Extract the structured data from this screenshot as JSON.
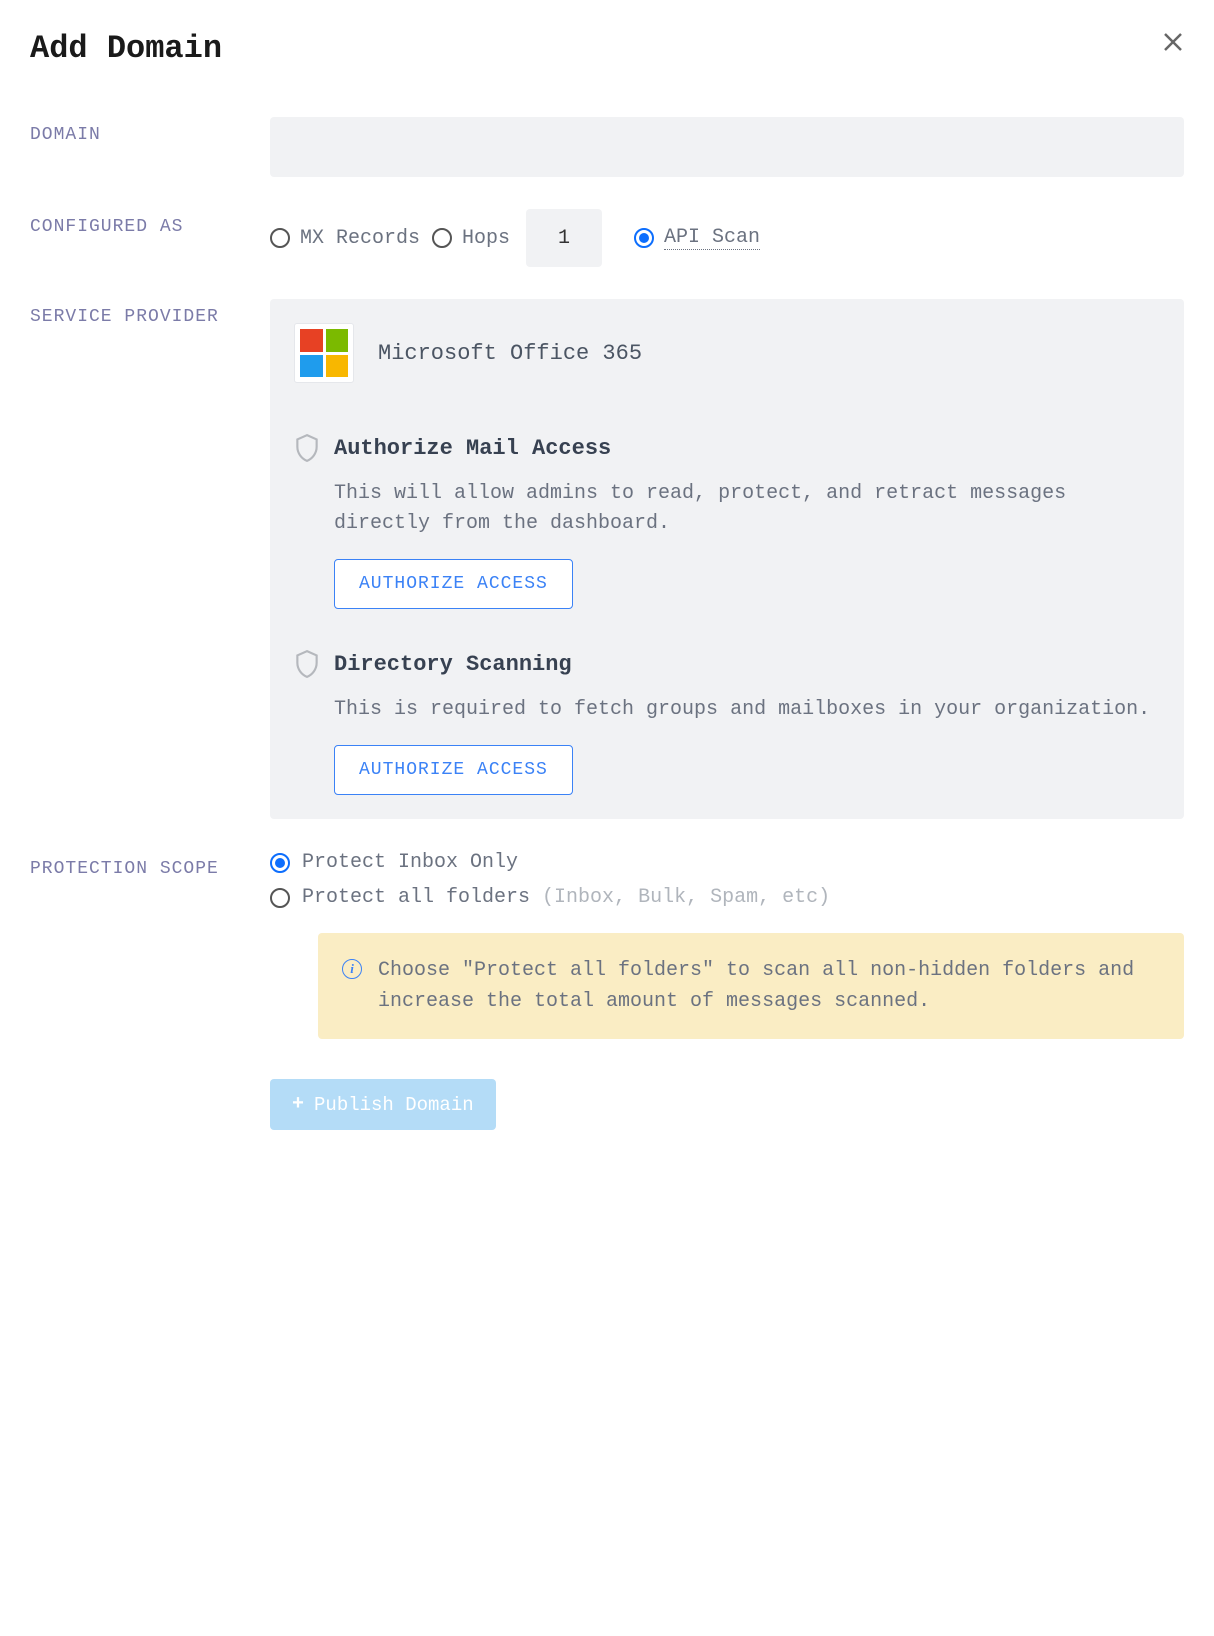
{
  "header": {
    "title": "Add Domain"
  },
  "labels": {
    "domain": "DOMAIN",
    "configured_as": "CONFIGURED AS",
    "service_provider": "SERVICE PROVIDER",
    "protection_scope": "PROTECTION SCOPE"
  },
  "domain": {
    "value": ""
  },
  "configured_as": {
    "options": {
      "mx": "MX Records",
      "hops": "Hops",
      "api": "API Scan"
    },
    "hops_value": "1",
    "selected": "api"
  },
  "provider": {
    "name": "Microsoft Office 365",
    "auth_mail": {
      "title": "Authorize Mail Access",
      "desc": "This will allow admins to read, protect, and retract messages directly from the dashboard.",
      "button": "AUTHORIZE ACCESS"
    },
    "auth_dir": {
      "title": "Directory Scanning",
      "desc": "This is required to fetch groups and mailboxes in your organization.",
      "button": "AUTHORIZE ACCESS"
    }
  },
  "scope": {
    "inbox": "Protect Inbox Only",
    "all": "Protect all folders",
    "all_hint": "(Inbox, Bulk, Spam, etc)",
    "selected": "inbox",
    "info": "Choose \"Protect all folders\" to scan all non-hidden folders and increase the total amount of messages scanned."
  },
  "publish": {
    "label": "Publish Domain"
  }
}
